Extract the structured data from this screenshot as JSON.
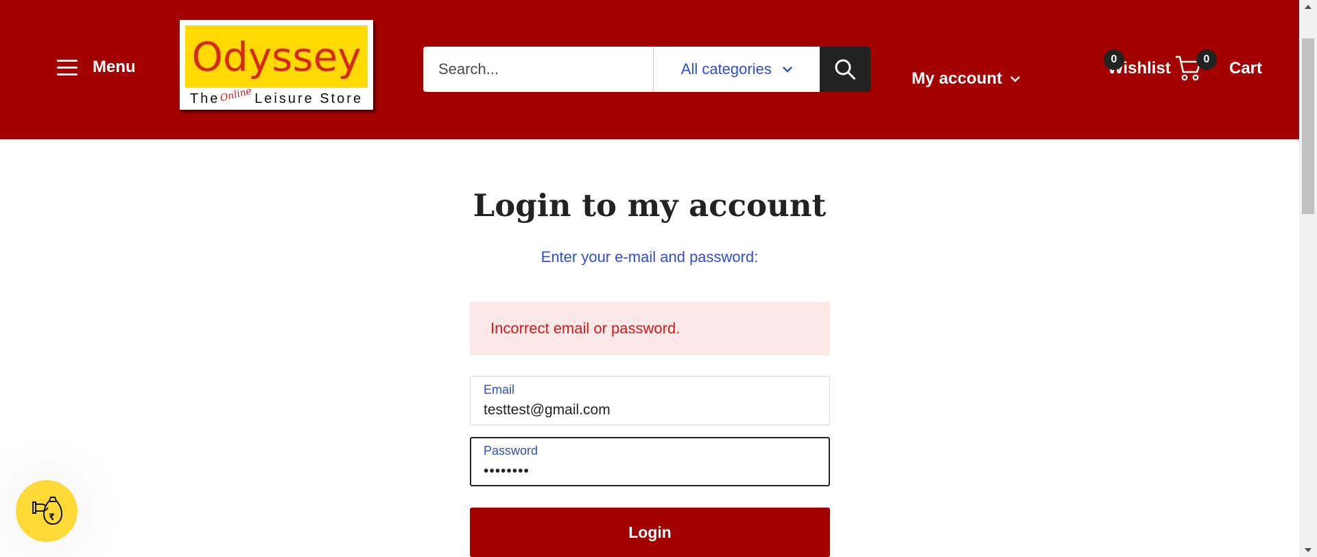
{
  "header": {
    "menu_label": "Menu",
    "logo": {
      "brand": "Odyssey",
      "tagline_the": "The",
      "tagline_online": "Online",
      "tagline_rest": "Leisure Store"
    },
    "search": {
      "placeholder": "Search...",
      "category": "All categories"
    },
    "account_label": "My account",
    "wishlist_label": "Wishlist",
    "wishlist_count": "0",
    "cart_label": "Cart",
    "cart_count": "0"
  },
  "main": {
    "title": "Login to my account",
    "subtitle": "Enter your e-mail and password:",
    "error": "Incorrect email or password.",
    "email_label": "Email",
    "email_value": "testtest@gmail.com",
    "password_label": "Password",
    "password_value": "••••••••",
    "login_button": "Login"
  },
  "colors": {
    "brand_red": "#a30000",
    "link_blue": "#2e4fcf",
    "error_red": "#d61a1a",
    "logo_yellow": "#ffd900"
  },
  "icons": [
    "hamburger-icon",
    "chevron-down-icon",
    "search-icon",
    "cart-icon",
    "loyalty-rupee-icon"
  ]
}
